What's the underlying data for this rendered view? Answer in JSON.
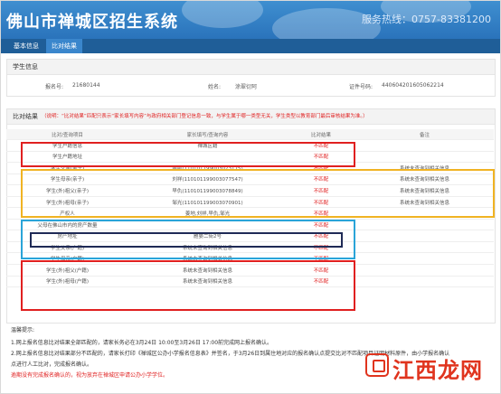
{
  "header": {
    "title": "佛山市禅城区招生系统",
    "hotline": "服务热线：0757-83381200"
  },
  "tabs": [
    {
      "label": "基本信息"
    },
    {
      "label": "比对结果"
    }
  ],
  "student": {
    "section_title": "学生信息",
    "reg_label": "报名号:",
    "reg_value": "21680144",
    "name_label": "姓名:",
    "name_value": "涂翠衍阿",
    "id_label": "证件号码:",
    "id_value": "440604201605062214"
  },
  "result": {
    "section_title": "比对结果",
    "note_prefix": "（说明：",
    "note": "“比对结果”匹配只表示“家长填写内容”与政府相关部门登记信息一致，与学生属于哪一类型无关，学生类型以教育部门最后审核结果为准。）",
    "columns": [
      "比对/查询项目",
      "家长填写/查询内容",
      "比对结果",
      "备注"
    ],
    "rows": [
      [
        "学生户籍信息",
        "禅城区籍",
        "不匹配",
        ""
      ],
      [
        "学生户籍地址",
        "",
        "不匹配",
        ""
      ],
      [
        "学生父亲(亲子)",
        "姜啦(110101199003073175)",
        "不匹配",
        "系统未查询到相关信息"
      ],
      [
        "学生母亲(亲子)",
        "刘祥(110101199003077547)",
        "不匹配",
        "系统未查询到相关信息"
      ],
      [
        "学生(外)祖父(亲子)",
        "早仇(110101199003078849)",
        "不匹配",
        "系统未查询到相关信息"
      ],
      [
        "学生(外)祖母(亲子)",
        "邹光(110101199003070901)",
        "不匹配",
        "系统未查询到相关信息"
      ],
      [
        "产权人",
        "姜地,刘祥,早仇,邹光",
        "不匹配",
        ""
      ],
      [
        "父母在佛山市内的房产数量",
        "",
        "不匹配",
        ""
      ],
      [
        "房产地址",
        "雁晏二街2号",
        "不匹配",
        ""
      ],
      [
        "学生父亲(户籍)",
        "系统未查询到相关信息",
        "不匹配",
        ""
      ],
      [
        "学生母亲(户籍)",
        "系统未查询到相关信息",
        "不匹配",
        ""
      ],
      [
        "学生(外)祖父(户籍)",
        "系统未查询到相关信息",
        "不匹配",
        ""
      ],
      [
        "学生(外)祖母(户籍)",
        "系统未查询到相关信息",
        "不匹配",
        ""
      ]
    ]
  },
  "footer": {
    "title": "温馨提示:",
    "line1": "1.网上报名信息比对结果全部匹配的，请家长务必在3月24日 10:00至3月26日 17:00前完成网上报名确认。",
    "line2": "2.网上报名信息比对结果部分不匹配的，请家长打印《禅城区公办小学报名信息表》并签名，于3月26日到属住地对应的报名确认点提交比对不匹配项目证明材料原件，由小学报名确认",
    "line3": "点进行人工比对，完成报名确认。",
    "line4": "逾期没有完成报名确认的，视为放弃在禅城区申请公办小学学位。"
  },
  "watermark": {
    "text": "江西龙网"
  },
  "colors": {
    "header": "#2a73bb",
    "highlight_red": "#e02020",
    "highlight_yellow": "#f0b323",
    "highlight_blue": "#2aa4d8",
    "highlight_navy": "#1f2a56"
  }
}
